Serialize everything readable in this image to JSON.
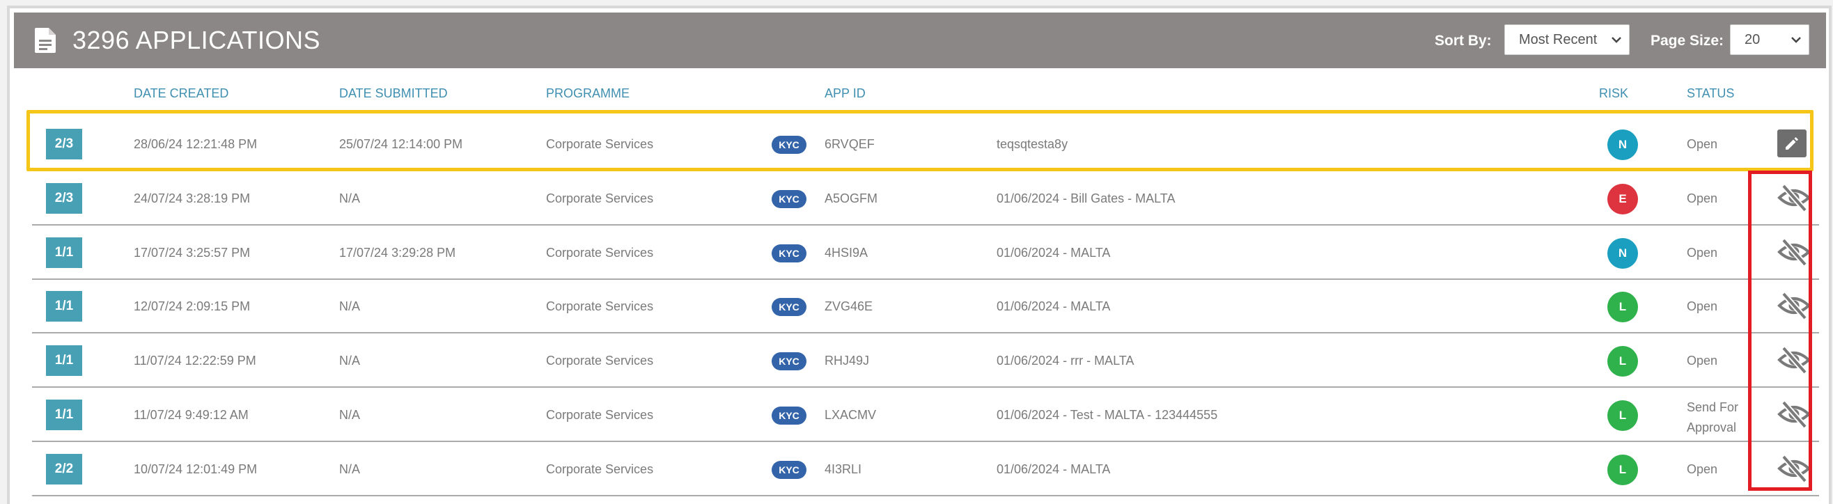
{
  "header": {
    "title": "3296 APPLICATIONS",
    "sort_label": "Sort By:",
    "sort_value": "Most Recent",
    "size_label": "Page Size:",
    "size_value": "20"
  },
  "columns": {
    "date_created": "DATE CREATED",
    "date_submitted": "DATE SUBMITTED",
    "programme": "PROGRAMME",
    "app_id": "APP ID",
    "risk": "RISK",
    "status": "STATUS"
  },
  "colors": {
    "header_bg": "#8c8787",
    "badge": "#48a0b4",
    "kyc": "#3364a9",
    "risk_N": "#1a9fc0",
    "risk_E": "#de3440",
    "risk_L": "#2fb24b",
    "highlight_selected": "#f5c518",
    "highlight_actions": "#e31b23"
  },
  "rows": [
    {
      "step": "2/3",
      "created": "28/06/24 12:21:48 PM",
      "submitted": "25/07/24 12:14:00 PM",
      "programme": "Corporate Services",
      "tag": "KYC",
      "app_id": "6RVQEF",
      "name": "teqsqtesta8y",
      "risk": "N",
      "status": "Open",
      "action": "edit-icon"
    },
    {
      "step": "2/3",
      "created": "24/07/24 3:28:19 PM",
      "submitted": "N/A",
      "programme": "Corporate Services",
      "tag": "KYC",
      "app_id": "A5OGFM",
      "name": "01/06/2024 - Bill Gates - MALTA",
      "risk": "E",
      "status": "Open",
      "action": "eye-slash-icon"
    },
    {
      "step": "1/1",
      "created": "17/07/24 3:25:57 PM",
      "submitted": "17/07/24 3:29:28 PM",
      "programme": "Corporate Services",
      "tag": "KYC",
      "app_id": "4HSI9A",
      "name": "01/06/2024 - MALTA",
      "risk": "N",
      "status": "Open",
      "action": "eye-slash-icon"
    },
    {
      "step": "1/1",
      "created": "12/07/24 2:09:15 PM",
      "submitted": "N/A",
      "programme": "Corporate Services",
      "tag": "KYC",
      "app_id": "ZVG46E",
      "name": "01/06/2024 - MALTA",
      "risk": "L",
      "status": "Open",
      "action": "eye-slash-icon"
    },
    {
      "step": "1/1",
      "created": "11/07/24 12:22:59 PM",
      "submitted": "N/A",
      "programme": "Corporate Services",
      "tag": "KYC",
      "app_id": "RHJ49J",
      "name": "01/06/2024 - rrr - MALTA",
      "risk": "L",
      "status": "Open",
      "action": "eye-slash-icon"
    },
    {
      "step": "1/1",
      "created": "11/07/24 9:49:12 AM",
      "submitted": "N/A",
      "programme": "Corporate Services",
      "tag": "KYC",
      "app_id": "LXACMV",
      "name": "01/06/2024 - Test - MALTA - 123444555",
      "risk": "L",
      "status": "Send For Approval",
      "action": "eye-slash-icon"
    },
    {
      "step": "2/2",
      "created": "10/07/24 12:01:49 PM",
      "submitted": "N/A",
      "programme": "Corporate Services",
      "tag": "KYC",
      "app_id": "4I3RLI",
      "name": "01/06/2024 - MALTA",
      "risk": "L",
      "status": "Open",
      "action": "eye-slash-icon"
    }
  ]
}
